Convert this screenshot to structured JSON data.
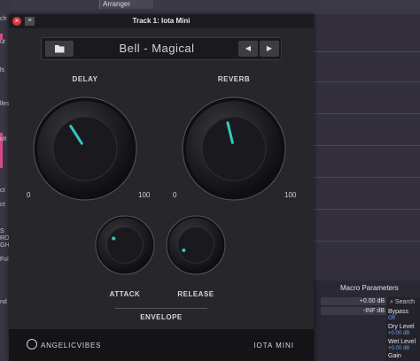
{
  "daw": {
    "arranger_tab": "Arranger",
    "left_fragments": [
      "ch",
      "ut",
      "ls",
      "lles",
      "ult",
      "ct",
      "ct",
      "S",
      "RO",
      "GHO",
      "Fold",
      "nd"
    ]
  },
  "macro": {
    "title": "Macro Parameters",
    "rows": [
      "+0.00 dB",
      "-INF dB"
    ],
    "search_placeholder": "Search",
    "items": [
      {
        "label": "Bypass",
        "value": "Off"
      },
      {
        "label": "Dry Level",
        "value": "+0.00 dB"
      },
      {
        "label": "Wet Level",
        "value": "+0.00 dB"
      },
      {
        "label": "Gain",
        "value": ""
      }
    ]
  },
  "window": {
    "title": "Track 1: Iota Mini",
    "close_label": "×",
    "menu_label": "≡"
  },
  "preset": {
    "name": "Bell - Magical",
    "prev_label": "◀",
    "next_label": "▶"
  },
  "knobs": {
    "delay": {
      "label": "DELAY",
      "min": "0",
      "max": "100",
      "value_fraction": 0.38
    },
    "reverb": {
      "label": "REVERB",
      "min": "0",
      "max": "100",
      "value_fraction": 0.45
    },
    "attack": {
      "label": "ATTACK",
      "value_fraction": 0.28
    },
    "release": {
      "label": "RELEASE",
      "value_fraction": 0.08
    }
  },
  "envelope_label": "ENVELOPE",
  "footer": {
    "brand": "ANGELICVIBES",
    "product": "IOTA MINI"
  },
  "colors": {
    "accent": "#31c9c2",
    "close": "#d8383d",
    "macro_value": "#6fa0ff"
  }
}
